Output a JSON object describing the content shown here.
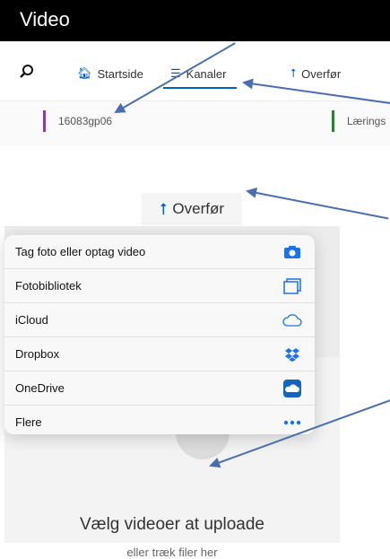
{
  "app": {
    "title": "Video"
  },
  "nav": {
    "search_icon": "search-icon",
    "items": [
      {
        "label": "Startside",
        "icon": "home-icon"
      },
      {
        "label": "Kanaler",
        "icon": "list-icon"
      },
      {
        "label": "Overfør",
        "icon": "upload-icon"
      }
    ]
  },
  "channels": [
    {
      "name": "16083gp06",
      "color": "#7b3fb2"
    },
    {
      "name": "Lærings",
      "color": "#2e7d32"
    }
  ],
  "upload_button": {
    "label": "Overfør",
    "icon": "upload-icon"
  },
  "share_sheet": {
    "options": [
      {
        "label": "Tag foto eller optag video",
        "icon": "camera-icon"
      },
      {
        "label": "Fotobibliotek",
        "icon": "photo-library-icon"
      },
      {
        "label": "iCloud",
        "icon": "icloud-icon"
      },
      {
        "label": "Dropbox",
        "icon": "dropbox-icon"
      },
      {
        "label": "OneDrive",
        "icon": "onedrive-icon"
      },
      {
        "label": "Flere",
        "icon": "more-icon"
      }
    ]
  },
  "dropzone": {
    "title": "Vælg videoer at uploade",
    "subtitle": "eller træk filer her"
  },
  "colors": {
    "accent": "#0060c0",
    "arrow": "#4a6fb0"
  }
}
